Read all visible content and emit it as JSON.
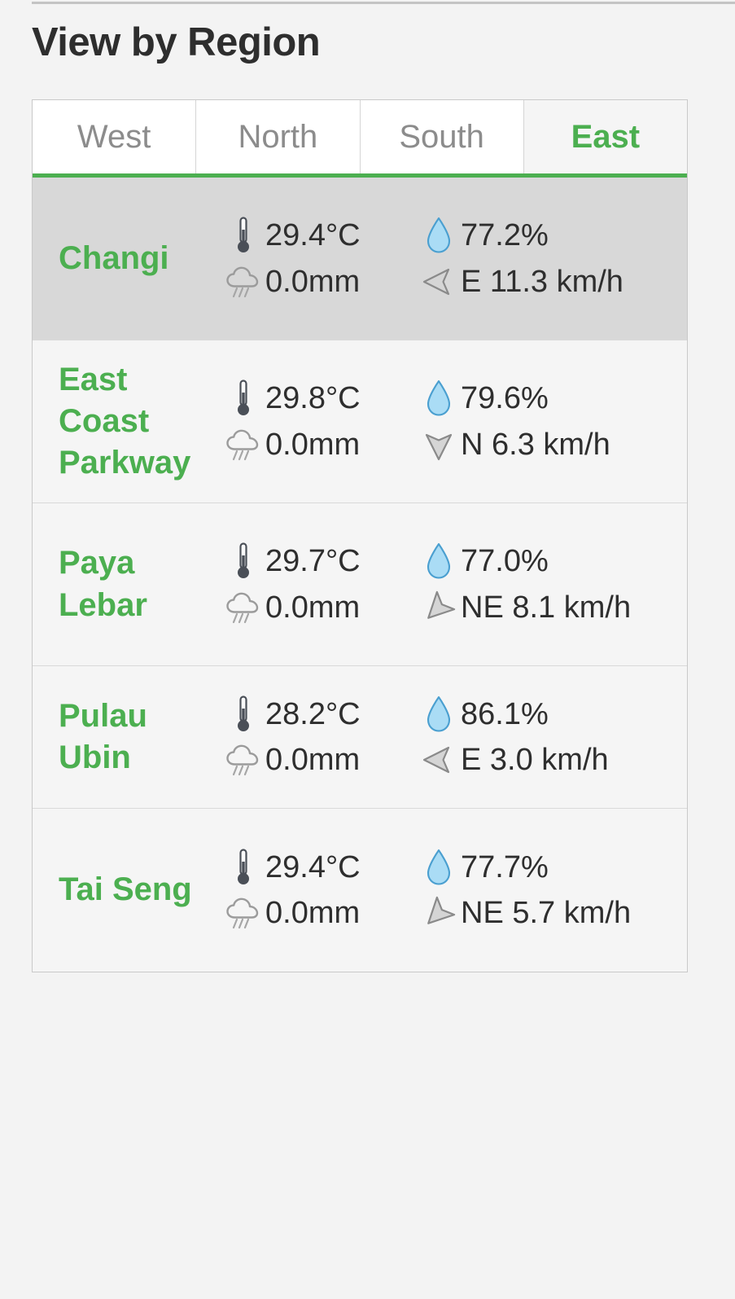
{
  "page": {
    "title": "View by Region",
    "accent_green": "#4caf50",
    "text_dark": "#2e2e2e",
    "inactive_tab_text": "#8c8c8c",
    "row_bg": "#f5f5f5",
    "row_highlight_bg": "#d8d8d8",
    "panel_border": "#c9c9c9",
    "droplet_fill": "#aadcf5",
    "droplet_stroke": "#4a9fd0"
  },
  "tabs": [
    {
      "label": "West",
      "active": false
    },
    {
      "label": "North",
      "active": false
    },
    {
      "label": "South",
      "active": false
    },
    {
      "label": "East",
      "active": true
    }
  ],
  "stations": [
    {
      "name": "Changi",
      "highlight": true,
      "compact": false,
      "temperature": "29.4°C",
      "rainfall": "0.0mm",
      "humidity": "77.2%",
      "wind": "E 11.3 km/h",
      "wind_direction": "E",
      "icons": {
        "temperature": "thermometer-icon",
        "rainfall": "rain-cloud-icon",
        "humidity": "water-droplet-icon",
        "wind": "wind-direction-arrow-icon"
      }
    },
    {
      "name": "East Coast Parkway",
      "highlight": false,
      "compact": false,
      "temperature": "29.8°C",
      "rainfall": "0.0mm",
      "humidity": "79.6%",
      "wind": "N 6.3 km/h",
      "wind_direction": "N",
      "icons": {
        "temperature": "thermometer-icon",
        "rainfall": "rain-cloud-icon",
        "humidity": "water-droplet-icon",
        "wind": "wind-direction-arrow-icon"
      }
    },
    {
      "name": "Paya Lebar",
      "highlight": false,
      "compact": false,
      "temperature": "29.7°C",
      "rainfall": "0.0mm",
      "humidity": "77.0%",
      "wind": "NE 8.1 km/h",
      "wind_direction": "NE",
      "icons": {
        "temperature": "thermometer-icon",
        "rainfall": "rain-cloud-icon",
        "humidity": "water-droplet-icon",
        "wind": "wind-direction-arrow-icon"
      }
    },
    {
      "name": "Pulau Ubin",
      "highlight": false,
      "compact": true,
      "temperature": "28.2°C",
      "rainfall": "0.0mm",
      "humidity": "86.1%",
      "wind": "E 3.0 km/h",
      "wind_direction": "E",
      "icons": {
        "temperature": "thermometer-icon",
        "rainfall": "rain-cloud-icon",
        "humidity": "water-droplet-icon",
        "wind": "wind-direction-arrow-icon"
      }
    },
    {
      "name": "Tai Seng",
      "highlight": false,
      "compact": false,
      "temperature": "29.4°C",
      "rainfall": "0.0mm",
      "humidity": "77.7%",
      "wind": "NE 5.7 km/h",
      "wind_direction": "NE",
      "icons": {
        "temperature": "thermometer-icon",
        "rainfall": "rain-cloud-icon",
        "humidity": "water-droplet-icon",
        "wind": "wind-direction-arrow-icon"
      }
    }
  ]
}
